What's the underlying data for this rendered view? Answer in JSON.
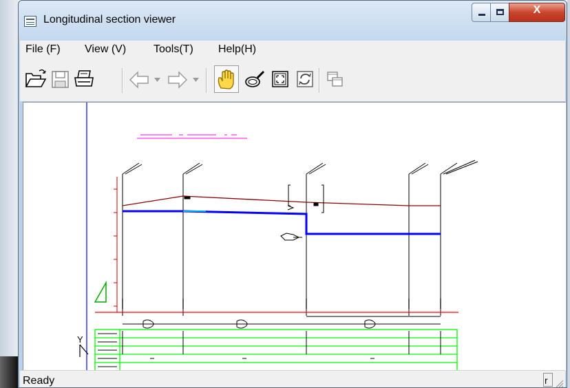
{
  "window": {
    "title": "Longitudinal section viewer"
  },
  "title_buttons": {
    "close_label": "X"
  },
  "menu": [
    {
      "label": "File (F)"
    },
    {
      "label": "View (V)"
    },
    {
      "label": "Tools(T)"
    },
    {
      "label": "Help(H)"
    }
  ],
  "toolbar": {
    "buttons": [
      {
        "icon": "open-folder-icon",
        "enabled": true
      },
      {
        "icon": "save-disk-icon",
        "enabled": false
      },
      {
        "icon": "print-icon",
        "enabled": true
      },
      {
        "icon": "back-arrow-icon",
        "enabled": false
      },
      {
        "icon": "forward-arrow-icon",
        "enabled": false
      },
      {
        "icon": "pan-hand-icon",
        "enabled": true,
        "active": true
      },
      {
        "icon": "zoom-magnifier-icon",
        "enabled": true
      },
      {
        "icon": "fit-to-window-icon",
        "enabled": true
      },
      {
        "icon": "refresh-icon",
        "enabled": true
      },
      {
        "icon": "copy-window-icon",
        "enabled": false
      }
    ]
  },
  "drawing": {
    "axis_letter": "Y",
    "colors": {
      "title_line": "#ff00ff",
      "ground_line": "#8b0000",
      "water_line": "#0000ff",
      "datum_line": "#ff0000",
      "table_grid": "#00ff00",
      "scale_ticks": "#cc0000",
      "axis_line": "#0000ff"
    }
  },
  "status": {
    "text": "Ready",
    "panel": "r"
  }
}
